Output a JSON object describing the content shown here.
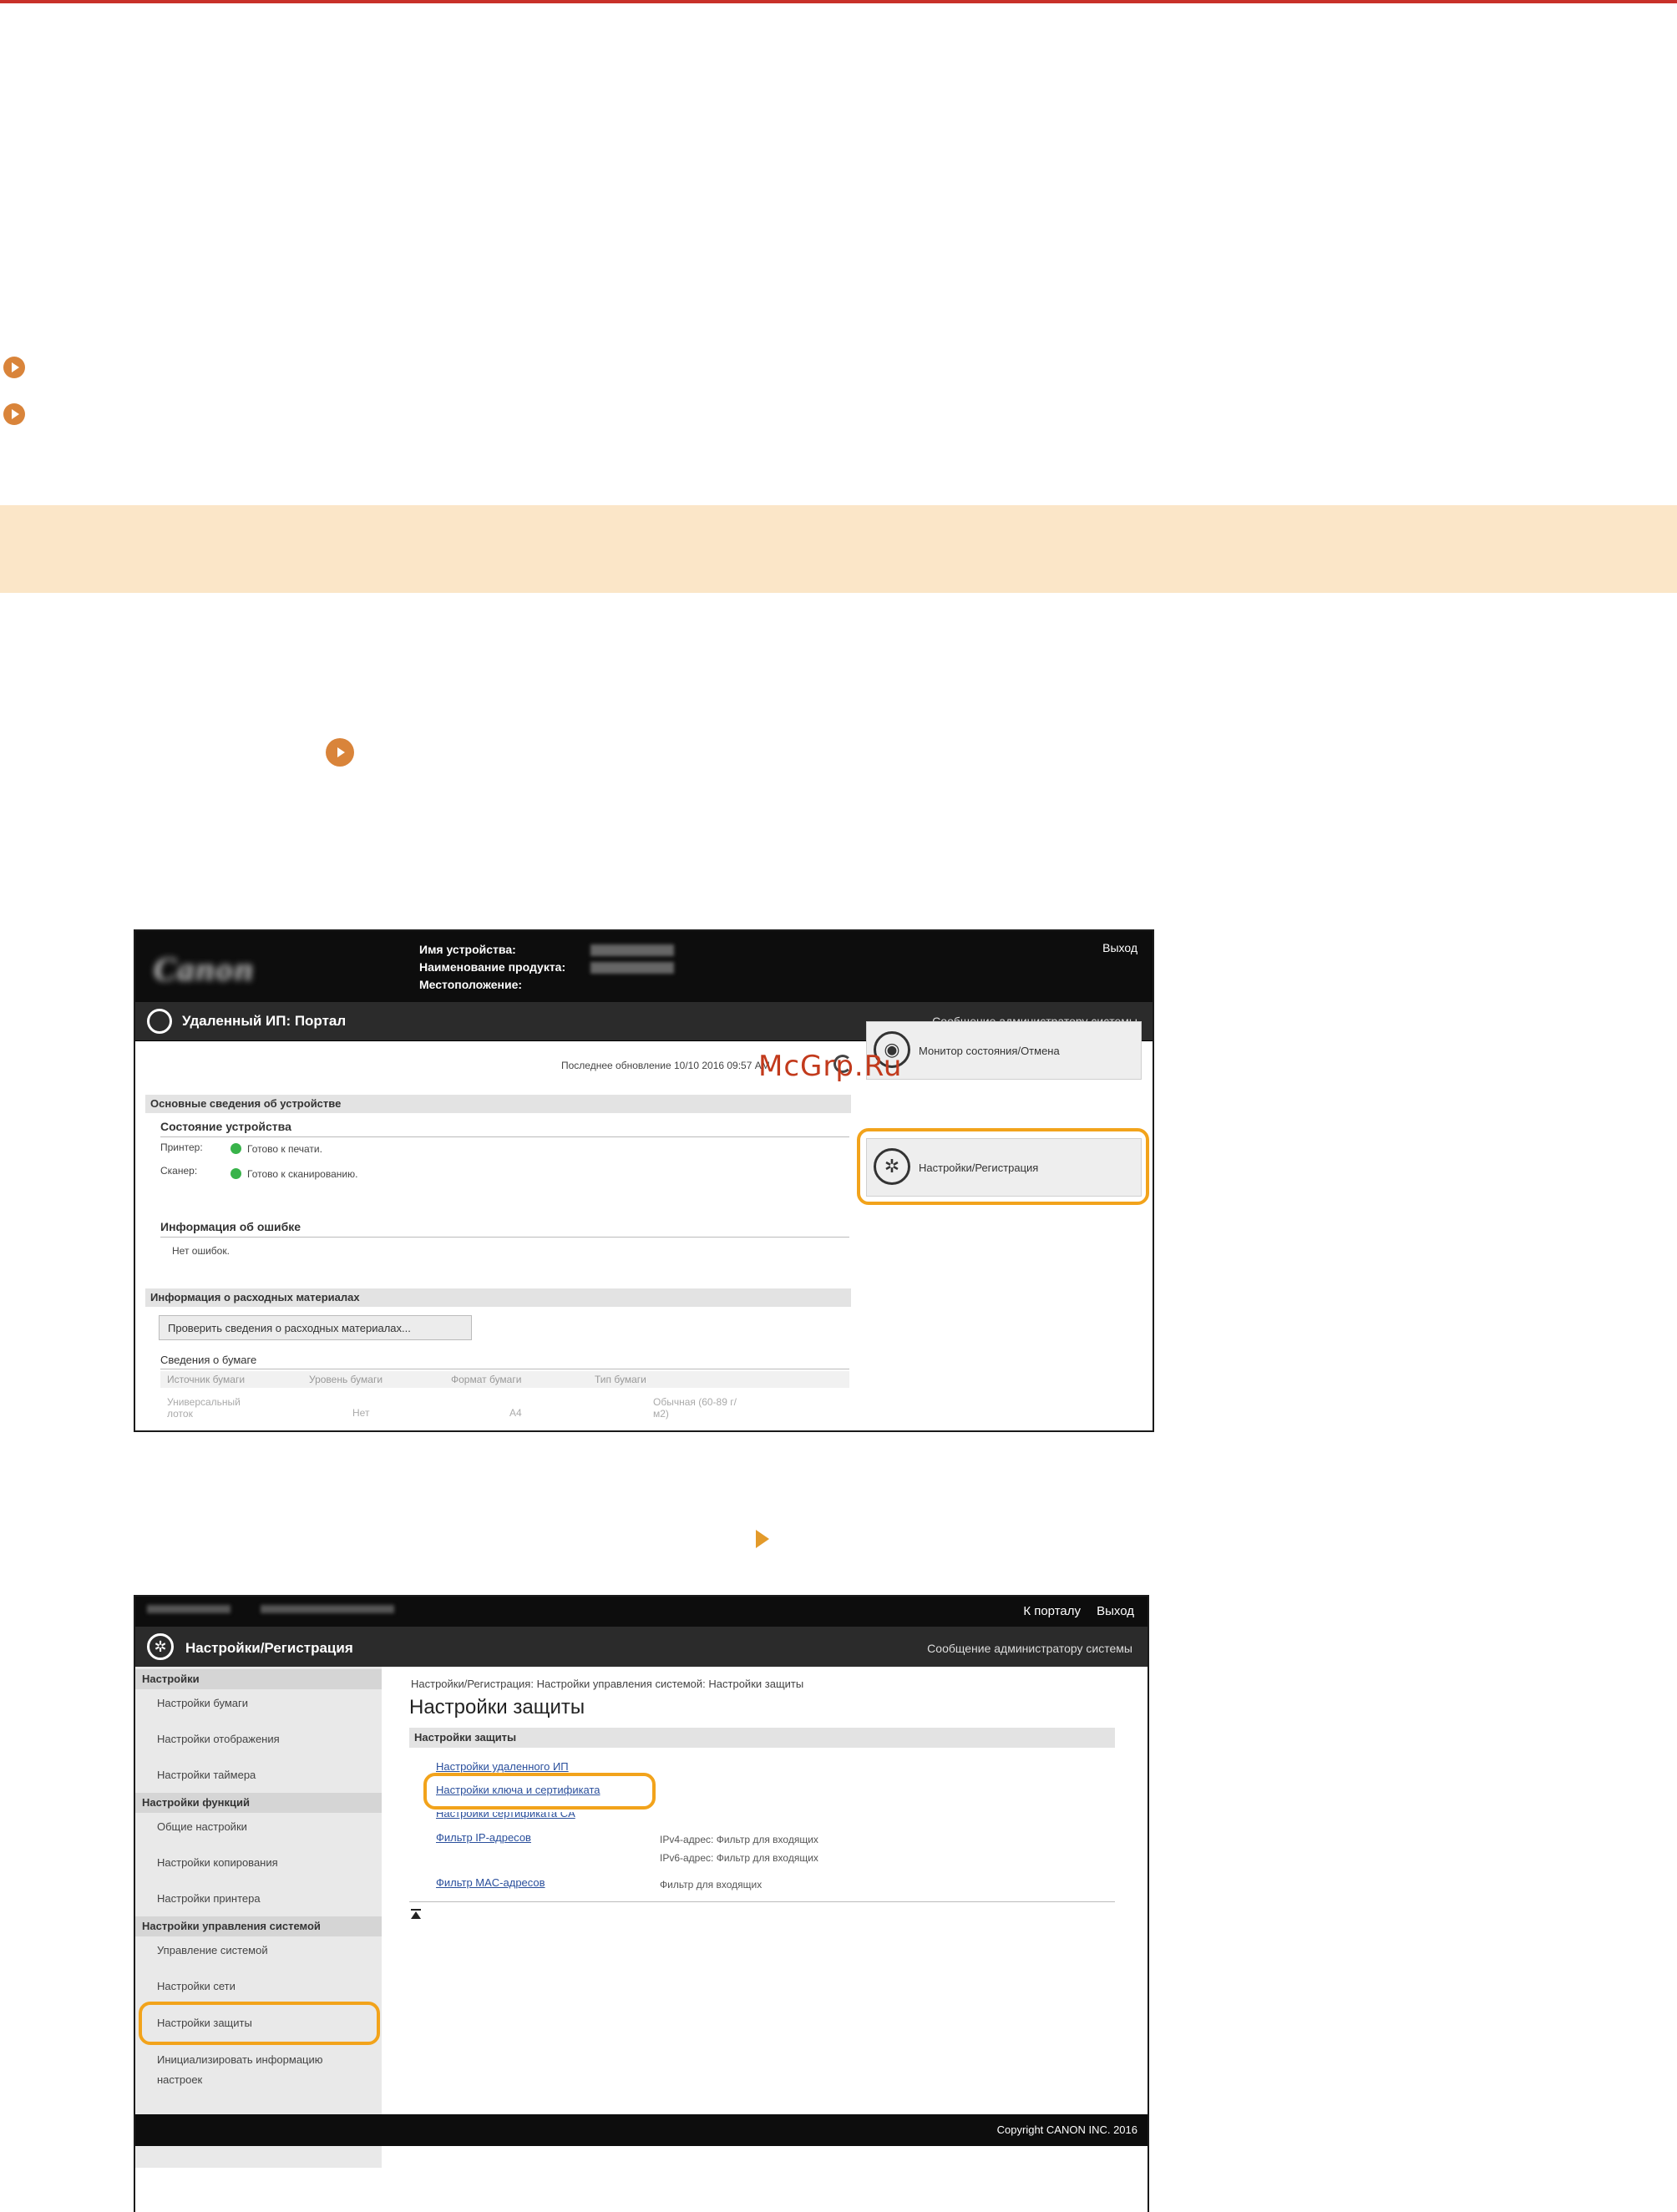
{
  "watermark": "McGrp.Ru",
  "screenshot1": {
    "logo_text": "Canon",
    "device_info_labels": [
      "Имя устройства:",
      "Наименование продукта:",
      "Местоположение:"
    ],
    "exit": "Выход",
    "portal_title": "Удаленный ИП: Портал",
    "admin_message": "Сообщение администратору системы",
    "last_updated": "Последнее обновление 10/10 2016 09:57 AM",
    "basic_info_heading": "Основные сведения об устройстве",
    "device_state_heading": "Состояние устройства",
    "printer_label": "Принтер:",
    "printer_status": "Готово к печати.",
    "scanner_label": "Сканер:",
    "scanner_status": "Готово к сканированию.",
    "error_heading": "Информация об ошибке",
    "error_text": "Нет ошибок.",
    "consumables_heading": "Информация о расходных материалах",
    "check_consumables_button": "Проверить сведения о расходных материалах...",
    "paper_info_heading": "Сведения о бумаге",
    "paper_table_headers": [
      "Источник бумаги",
      "Уровень бумаги",
      "Формат бумаги",
      "Тип бумаги"
    ],
    "paper_row": [
      "Универсальный лоток",
      "Нет",
      "A4",
      "Обычная (60-89 г/м2)"
    ],
    "monitor_card": "Монитор состояния/Отмена",
    "settings_card": "Настройки/Регистрация"
  },
  "screenshot2": {
    "portal_link": "К порталу",
    "exit": "Выход",
    "title": "Настройки/Регистрация",
    "admin_message": "Сообщение администратору системы",
    "sidebar": {
      "group1": "Настройки",
      "group1_items": [
        "Настройки бумаги",
        "Настройки отображения",
        "Настройки таймера"
      ],
      "group2": "Настройки функций",
      "group2_items": [
        "Общие настройки",
        "Настройки копирования",
        "Настройки принтера"
      ],
      "group3": "Настройки управления системой",
      "group3_items": [
        "Управление системой",
        "Настройки сети",
        "Настройки защиты",
        "Инициализировать информацию",
        "настроек"
      ]
    },
    "breadcrumb": "Настройки/Регистрация: Настройки управления системой: Настройки защиты",
    "page_title": "Настройки защиты",
    "section_heading": "Настройки защиты",
    "links": [
      "Настройки удаленного ИП",
      "Настройки ключа и сертификата",
      "Настройки сертификата CA",
      "Фильтр IP-адресов",
      "Фильтр MAC-адресов"
    ],
    "ip_filter_desc": [
      "IPv4-адрес: Фильтр для входящих",
      "IPv6-адрес: Фильтр для входящих"
    ],
    "mac_filter_desc": "Фильтр для входящих",
    "copyright": "Copyright CANON INC. 2016"
  }
}
